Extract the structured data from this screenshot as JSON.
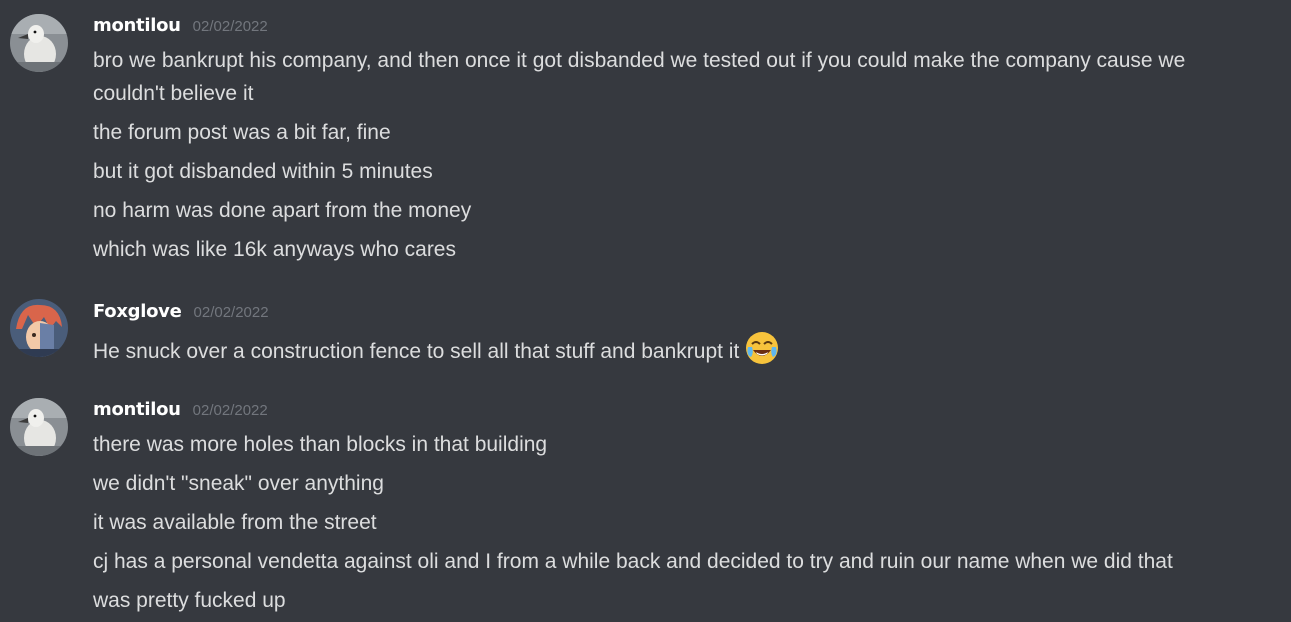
{
  "messages": [
    {
      "username": "montilou",
      "timestamp": "02/02/2022",
      "avatar": "duck-avatar",
      "lines": [
        "bro we bankrupt his company, and then once it got disbanded we tested out if you could make the company cause we",
        "couldn't believe it",
        "the forum post was a bit far, fine",
        "but it got disbanded within 5 minutes",
        "no harm was done apart from the money",
        "which was like 16k anyways who cares"
      ]
    },
    {
      "username": "Foxglove",
      "timestamp": "02/02/2022",
      "avatar": "anime-character-avatar",
      "lines": [
        "He snuck over a construction fence to sell all that stuff and bankrupt it"
      ],
      "emoji": "joy-emoji"
    },
    {
      "username": "montilou",
      "timestamp": "02/02/2022",
      "avatar": "duck-avatar",
      "lines": [
        "there was more holes than blocks in that building",
        "we didn't \"sneak\" over anything",
        "it was available from the street",
        "cj has a personal vendetta against oli and I from a while back and decided to try and ruin our name when we did that",
        "was pretty fucked up"
      ]
    }
  ],
  "colors": {
    "background": "#36393f",
    "username": "#ffffff",
    "timestamp": "#72767d",
    "text": "#dcddde"
  }
}
